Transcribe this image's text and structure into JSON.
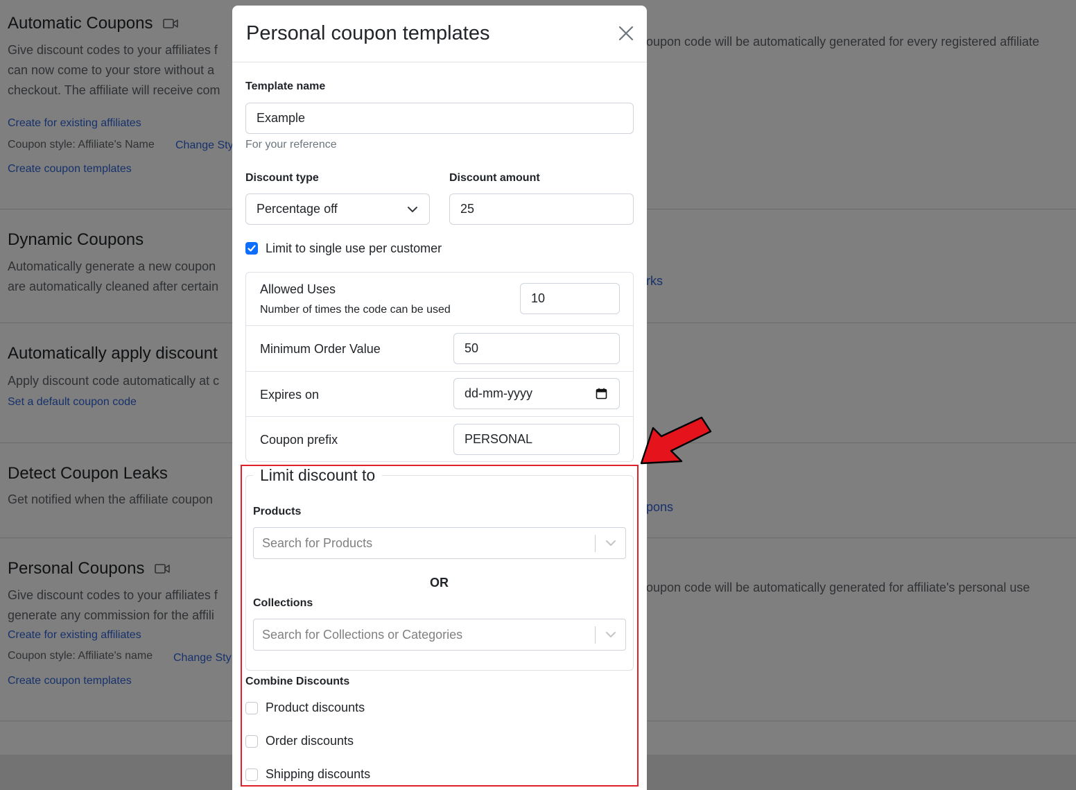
{
  "background": {
    "sections": [
      {
        "title": "Automatic Coupons",
        "has_video_icon": true,
        "desc_lines": [
          "Give discount codes to your affiliates f",
          "can now come to your store without a",
          "checkout. The affiliate will receive com"
        ],
        "right_text": "oupon code will be automatically generated for every registered affiliate",
        "links": [
          "Create for existing affiliates",
          "Change Sty",
          "Create coupon templates"
        ],
        "note": "Coupon style: Affiliate's Name"
      },
      {
        "title": "Dynamic Coupons",
        "desc_lines": [
          "Automatically generate a new coupon",
          "are automatically cleaned after certain"
        ],
        "right_link": "rks"
      },
      {
        "title": "Automatically apply discount",
        "desc_lines": [
          "Apply discount code automatically at c"
        ],
        "links": [
          "Set a default coupon code"
        ]
      },
      {
        "title": "Detect Coupon Leaks",
        "desc_lines": [
          "Get notified when the affiliate coupon"
        ],
        "right_link": "pons"
      },
      {
        "title": "Personal Coupons",
        "has_video_icon": true,
        "desc_lines": [
          "Give discount codes to your affiliates f",
          "generate any commission for the affili"
        ],
        "right_text": "oupon code will be automatically generated for affiliate's personal use",
        "links": [
          "Create for existing affiliates",
          "Change Sty",
          "Create coupon templates"
        ],
        "note": "Coupon style: Affiliate's name"
      }
    ]
  },
  "modal": {
    "title": "Personal coupon templates",
    "template_name_label": "Template name",
    "template_name_value": "Example",
    "template_name_help": "For your reference",
    "discount_type_label": "Discount type",
    "discount_type_value": "Percentage off",
    "discount_amount_label": "Discount amount",
    "discount_amount_value": "25",
    "single_use_label": "Limit to single use per customer",
    "single_use_checked": true,
    "allowed_uses_label": "Allowed Uses",
    "allowed_uses_help": "Number of times the code can be used",
    "allowed_uses_value": "10",
    "min_order_label": "Minimum Order Value",
    "min_order_value": "50",
    "expires_label": "Expires on",
    "expires_placeholder": "dd-mm-yyyy",
    "prefix_label": "Coupon prefix",
    "prefix_value": "PERSONAL",
    "limit_legend": "Limit discount to",
    "products_label": "Products",
    "products_placeholder": "Search for Products",
    "or_text": "OR",
    "collections_label": "Collections",
    "collections_placeholder": "Search for Collections or Categories",
    "combine_label": "Combine Discounts",
    "combine_options": [
      {
        "label": "Product discounts",
        "checked": false
      },
      {
        "label": "Order discounts",
        "checked": false
      },
      {
        "label": "Shipping discounts",
        "checked": false
      }
    ]
  },
  "colors": {
    "highlight": "#e0212a",
    "link": "#2c63d6",
    "checkbox_checked": "#0d6efd"
  }
}
